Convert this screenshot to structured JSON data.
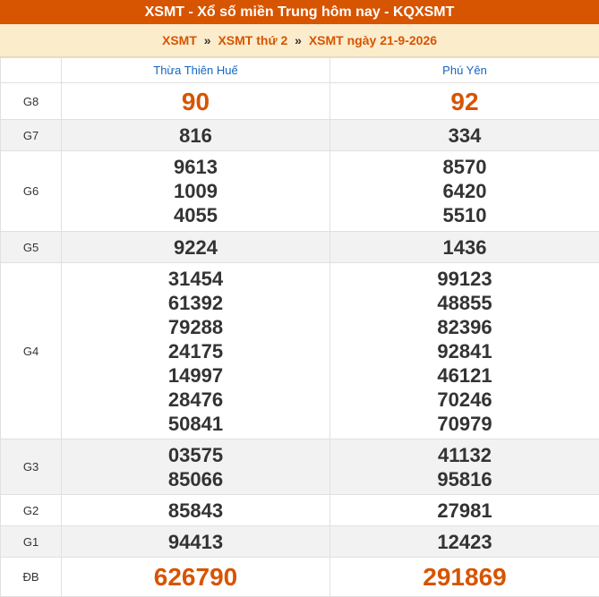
{
  "header": {
    "title": "XSMT - Xổ số miền Trung hôm nay - KQXSMT",
    "breadcrumb": [
      {
        "label": "XSMT"
      },
      {
        "label": "XSMT thứ 2"
      },
      {
        "label": "XSMT ngày 21-9-2026"
      }
    ],
    "separator": "»"
  },
  "table": {
    "provinces": [
      "Thừa Thiên Huế",
      "Phú Yên"
    ],
    "rows": [
      {
        "label": "G8",
        "style": "hi",
        "alt": false,
        "values": [
          [
            "90"
          ],
          [
            "92"
          ]
        ]
      },
      {
        "label": "G7",
        "style": "",
        "alt": true,
        "values": [
          [
            "816"
          ],
          [
            "334"
          ]
        ]
      },
      {
        "label": "G6",
        "style": "",
        "alt": false,
        "values": [
          [
            "9613",
            "1009",
            "4055"
          ],
          [
            "8570",
            "6420",
            "5510"
          ]
        ]
      },
      {
        "label": "G5",
        "style": "",
        "alt": true,
        "values": [
          [
            "9224"
          ],
          [
            "1436"
          ]
        ]
      },
      {
        "label": "G4",
        "style": "",
        "alt": false,
        "values": [
          [
            "31454",
            "61392",
            "79288",
            "24175",
            "14997",
            "28476",
            "50841"
          ],
          [
            "99123",
            "48855",
            "82396",
            "92841",
            "46121",
            "70246",
            "70979"
          ]
        ]
      },
      {
        "label": "G3",
        "style": "",
        "alt": true,
        "values": [
          [
            "03575",
            "85066"
          ],
          [
            "41132",
            "95816"
          ]
        ]
      },
      {
        "label": "G2",
        "style": "",
        "alt": false,
        "values": [
          [
            "85843"
          ],
          [
            "27981"
          ]
        ]
      },
      {
        "label": "G1",
        "style": "",
        "alt": true,
        "values": [
          [
            "94413"
          ],
          [
            "12423"
          ]
        ]
      },
      {
        "label": "ĐB",
        "style": "db",
        "alt": false,
        "values": [
          [
            "626790"
          ],
          [
            "291869"
          ]
        ]
      }
    ]
  },
  "colors": {
    "accent": "#d75400",
    "crumb_bg": "#fbeccc",
    "province_text": "#1565c0"
  }
}
